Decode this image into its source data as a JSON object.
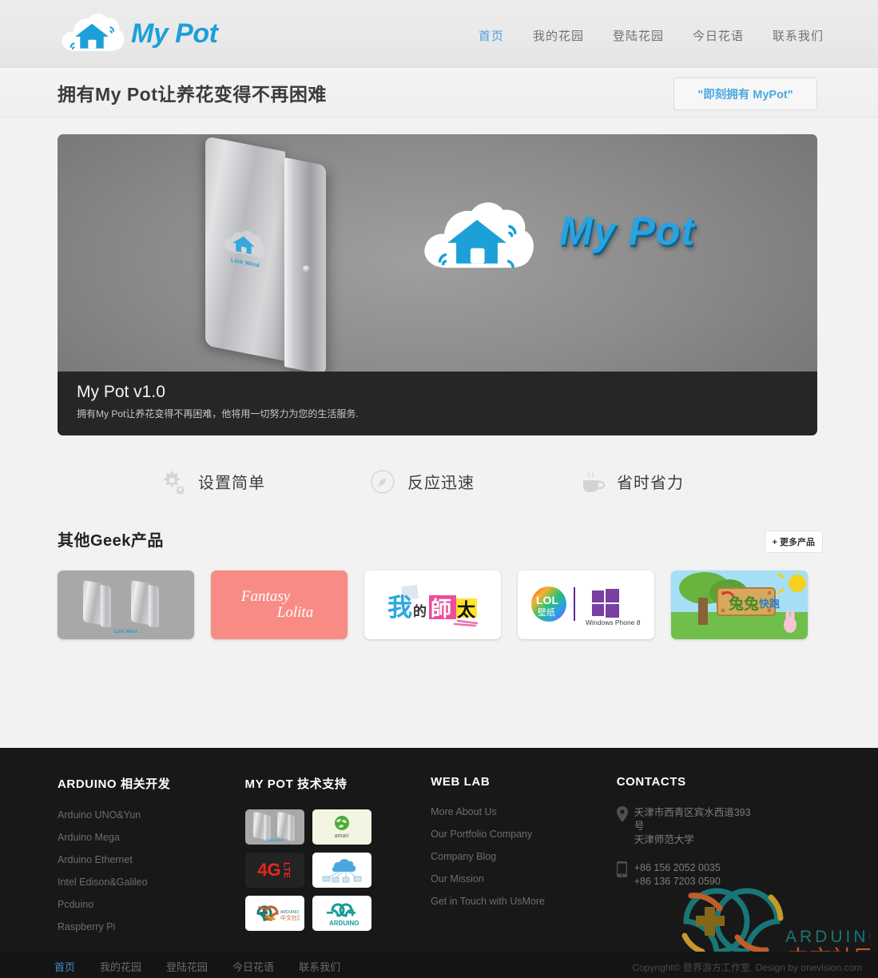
{
  "header": {
    "logo_text": "My Pot",
    "logo_icon": "cloud-house-wifi-icon",
    "nav": [
      {
        "label": "首页",
        "active": true
      },
      {
        "label": "我的花园",
        "active": false
      },
      {
        "label": "登陆花园",
        "active": false
      },
      {
        "label": "今日花语",
        "active": false
      },
      {
        "label": "联系我们",
        "active": false
      }
    ]
  },
  "title_bar": {
    "title": "拥有My Pot让养花变得不再困难",
    "cta_label": "\"即刻拥有 MyPot\""
  },
  "hero": {
    "wordmark": "My Pot",
    "device_logo_caption": "Link Wind",
    "caption_title": "My Pot v1.0",
    "caption_text": "拥有My Pot让养花变得不再困难，他将用一切努力为您的生活服务."
  },
  "features": [
    {
      "label": "设置简单",
      "icon": "gears-icon"
    },
    {
      "label": "反应迅速",
      "icon": "compass-icon"
    },
    {
      "label": "省时省力",
      "icon": "coffee-cup-icon"
    }
  ],
  "products": {
    "heading": "其他Geek产品",
    "more_label": "+ 更多产品",
    "cards": [
      {
        "name": "link-wind",
        "caption": "Link Wind"
      },
      {
        "name": "fantasy-lolita",
        "line1": "Fantasy",
        "line2": "Lolita"
      },
      {
        "name": "wo-de-shi-tai",
        "caption": "我的師太"
      },
      {
        "name": "lol-wallpaper",
        "caption": "LOL壁纸",
        "secondary": "Windows Phone 8"
      },
      {
        "name": "tu-tu-kuai-pao",
        "caption": "兔兔快跑"
      }
    ]
  },
  "footer": {
    "columns": [
      {
        "heading": "ARDUINO 相关开发",
        "links": [
          "Arduino UNO&Yun",
          "Arduino Mega",
          "Arduino Ethernet",
          "Intel Edison&Galileo",
          "Pcduino",
          "Raspberry Pi"
        ]
      },
      {
        "heading": "MY POT 技术支持",
        "thumbs": [
          {
            "name": "link-wind-thumb",
            "caption": "Link Wind"
          },
          {
            "name": "amari-thumb",
            "caption": "amari"
          },
          {
            "name": "4g-lte-thumb",
            "caption": "4G",
            "sub": "LTE"
          },
          {
            "name": "cloud-network-thumb",
            "caption": ""
          },
          {
            "name": "arduino-cn-thumb",
            "caption": "ARDUINO",
            "sub": "中文社区"
          },
          {
            "name": "arduino-thumb",
            "caption": "ARDUINO"
          }
        ]
      },
      {
        "heading": "WEB LAB",
        "links": [
          "More About Us",
          "Our Portfolio Company",
          "Company Blog",
          "Our Mission",
          "Get in Touch with UsMore"
        ]
      },
      {
        "heading": "CONTACTS",
        "address_line1": "天津市西青区宾水西道393号",
        "address_line2": "天津师范大学",
        "phone1": "+86 156 2052 0035",
        "phone2": "+86 136 7203 0590"
      }
    ],
    "watermark": {
      "name": "arduino-cn-watermark",
      "text": "ARDUINO",
      "sub": "中文社区"
    }
  },
  "bottom_bar": {
    "nav": [
      {
        "label": "首页",
        "active": true
      },
      {
        "label": "我的花园",
        "active": false
      },
      {
        "label": "登陆花园",
        "active": false
      },
      {
        "label": "今日花语",
        "active": false
      },
      {
        "label": "联系我们",
        "active": false
      }
    ],
    "copyright": "Copyright© 登界游方工作室. Design by onevision.com"
  },
  "colors": {
    "brand_blue": "#1d9fd8",
    "nav_active": "#4a9fd8",
    "footer_bg": "#181818",
    "bottom_bg": "#141414",
    "pink_card": "#f98b85",
    "arduino_teal": "#1a7c7c"
  }
}
